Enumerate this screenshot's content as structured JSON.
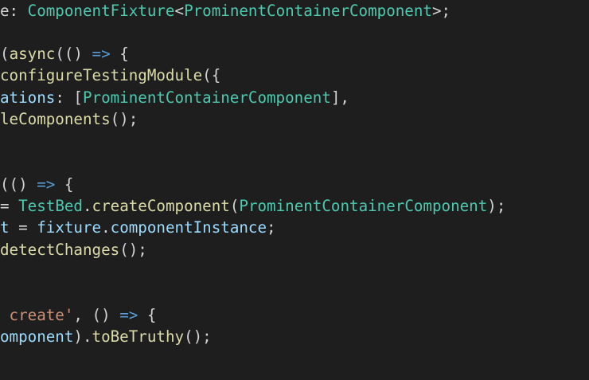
{
  "editor": {
    "theme_colors": {
      "background": "#1e1e1e",
      "default": "#d4d4d4",
      "type": "#4ec9b0",
      "keyword": "#569cd6",
      "function": "#dcdcaa",
      "variable": "#9cdcfe",
      "string": "#ce9178"
    },
    "lines": [
      [
        {
          "text": "e: ",
          "kind": "default"
        },
        {
          "text": "ComponentFixture",
          "kind": "type"
        },
        {
          "text": "<",
          "kind": "default"
        },
        {
          "text": "ProminentContainerComponent",
          "kind": "type"
        },
        {
          "text": ">;",
          "kind": "default"
        }
      ],
      [],
      [
        {
          "text": "(",
          "kind": "default"
        },
        {
          "text": "async",
          "kind": "func"
        },
        {
          "text": "(() ",
          "kind": "default"
        },
        {
          "text": "=>",
          "kind": "keyword"
        },
        {
          "text": " {",
          "kind": "default"
        }
      ],
      [
        {
          "text": "configureTestingModule",
          "kind": "func"
        },
        {
          "text": "({",
          "kind": "default"
        }
      ],
      [
        {
          "text": "ations",
          "kind": "var"
        },
        {
          "text": ": [",
          "kind": "default"
        },
        {
          "text": "ProminentContainerComponent",
          "kind": "type"
        },
        {
          "text": "],",
          "kind": "default"
        }
      ],
      [
        {
          "text": "leComponents",
          "kind": "func"
        },
        {
          "text": "();",
          "kind": "default"
        }
      ],
      [],
      [],
      [
        {
          "text": "(() ",
          "kind": "default"
        },
        {
          "text": "=>",
          "kind": "keyword"
        },
        {
          "text": " {",
          "kind": "default"
        }
      ],
      [
        {
          "text": "= ",
          "kind": "default"
        },
        {
          "text": "TestBed",
          "kind": "type"
        },
        {
          "text": ".",
          "kind": "default"
        },
        {
          "text": "createComponent",
          "kind": "func"
        },
        {
          "text": "(",
          "kind": "default"
        },
        {
          "text": "ProminentContainerComponent",
          "kind": "type"
        },
        {
          "text": ");",
          "kind": "default"
        }
      ],
      [
        {
          "text": "t",
          "kind": "var"
        },
        {
          "text": " = ",
          "kind": "default"
        },
        {
          "text": "fixture",
          "kind": "var"
        },
        {
          "text": ".",
          "kind": "default"
        },
        {
          "text": "componentInstance",
          "kind": "var"
        },
        {
          "text": ";",
          "kind": "default"
        }
      ],
      [
        {
          "text": "detectChanges",
          "kind": "func"
        },
        {
          "text": "();",
          "kind": "default"
        }
      ],
      [],
      [],
      [
        {
          "text": " create'",
          "kind": "string"
        },
        {
          "text": ", () ",
          "kind": "default"
        },
        {
          "text": "=>",
          "kind": "keyword"
        },
        {
          "text": " {",
          "kind": "default"
        }
      ],
      [
        {
          "text": "omponent",
          "kind": "var"
        },
        {
          "text": ").",
          "kind": "default"
        },
        {
          "text": "toBeTruthy",
          "kind": "func"
        },
        {
          "text": "();",
          "kind": "default"
        }
      ],
      [],
      []
    ]
  }
}
